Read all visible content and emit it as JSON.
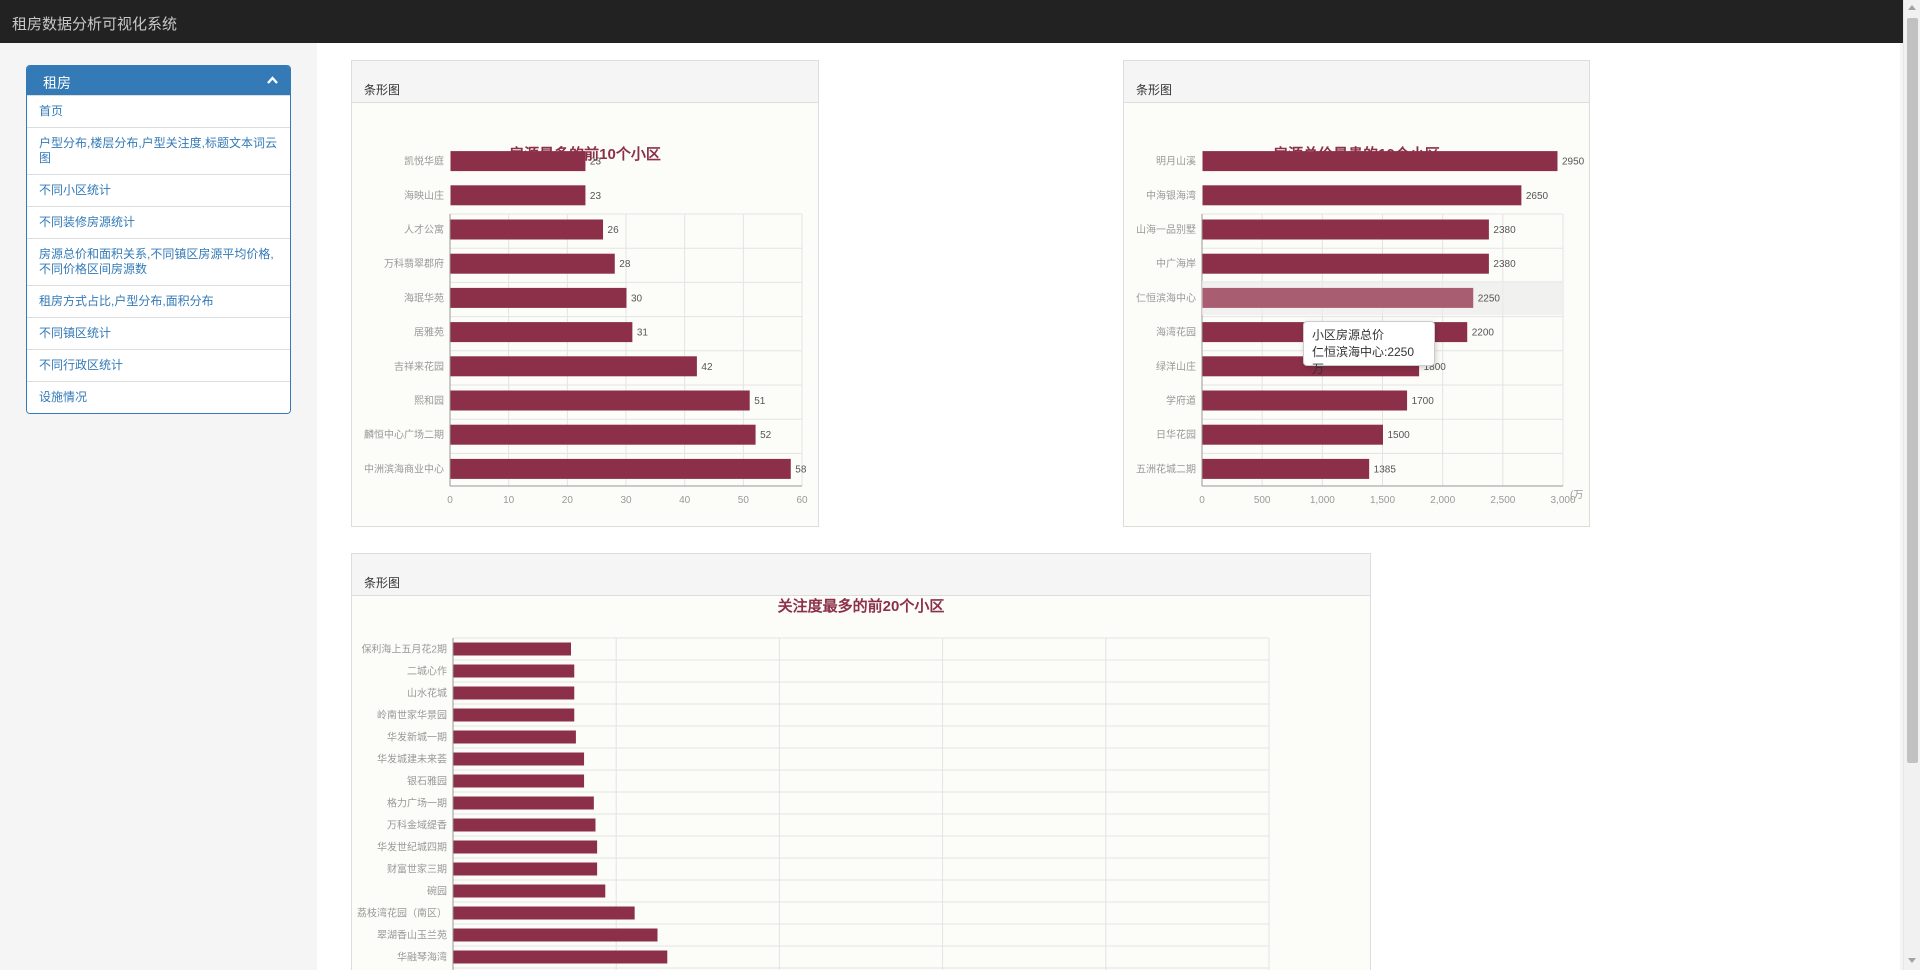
{
  "app": {
    "title": "租房数据分析可视化系统"
  },
  "sidebar": {
    "header": "租房",
    "items": [
      {
        "label": "首页"
      },
      {
        "label": "户型分布,楼层分布,户型关注度,标题文本词云图"
      },
      {
        "label": "不同小区统计"
      },
      {
        "label": "不同装修房源统计"
      },
      {
        "label": "房源总价和面积关系,不同镇区房源平均价格,不同价格区间房源数"
      },
      {
        "label": "租房方式占比,户型分布,面积分布"
      },
      {
        "label": "不同镇区统计"
      },
      {
        "label": "不同行政区统计"
      },
      {
        "label": "设施情况"
      }
    ]
  },
  "panels": [
    {
      "header": "条形图"
    },
    {
      "header": "条形图"
    },
    {
      "header": "条形图"
    }
  ],
  "colors": {
    "bar": "#8b3048",
    "bar_highlight": "#a85d70",
    "title": "#8b3048",
    "accent": "#337ab7"
  },
  "tooltip": {
    "title": "小区房源总价",
    "text": "仁恒滨海中心:2250万"
  },
  "chart_data": [
    {
      "type": "bar",
      "orientation": "horizontal",
      "title": "房源最多的前10个小区",
      "categories": [
        "中洲滨海商业中心",
        "麟恒中心广场二期",
        "熙和园",
        "吉祥来花园",
        "居雅苑",
        "海珉华苑",
        "万科翡翠郡府",
        "人才公寓",
        "海映山庄",
        "凯悦华庭"
      ],
      "values": [
        58,
        52,
        51,
        42,
        31,
        30,
        28,
        26,
        23,
        23
      ],
      "xlim": [
        0,
        60
      ],
      "xticks": [
        0,
        10,
        20,
        30,
        40,
        50,
        60
      ],
      "data_labels": true,
      "grid": true
    },
    {
      "type": "bar",
      "orientation": "horizontal",
      "title": "房源总价最贵的10个小区",
      "categories": [
        "五洲花城二期",
        "日华花园",
        "学府道",
        "绿洋山庄",
        "海湾花园",
        "仁恒滨海中心",
        "中广海岸",
        "山海一品别墅",
        "中海银海湾",
        "明月山溪"
      ],
      "values": [
        1385,
        1500,
        1700,
        1800,
        2200,
        2250,
        2380,
        2380,
        2650,
        2950
      ],
      "xlim": [
        0,
        3000
      ],
      "xticks": [
        "0",
        "500",
        "1,000",
        "1,500",
        "2,000",
        "2,500",
        "3,000"
      ],
      "xunit": "(万",
      "highlight_category": "仁恒滨海中心",
      "data_labels": true,
      "grid": true
    },
    {
      "type": "bar",
      "orientation": "horizontal",
      "title": "关注度最多的前20个小区",
      "categories": [
        "保利海上五月花2期",
        "二城心作",
        "山水花城",
        "岭南世家华景园",
        "华发新城一期",
        "华发城建未来荟",
        "银石雅园",
        "格力广场一期",
        "万科金域缇香",
        "华发世纪城四期",
        "财富世家三期",
        "碗园",
        "荔枝湾花园（南区）",
        "翠湖香山玉兰苑",
        "华融琴海湾"
      ],
      "values": [
        72,
        74,
        74,
        74,
        75,
        80,
        80,
        86,
        87,
        88,
        88,
        93,
        111,
        125,
        131
      ],
      "xlim": [
        0,
        500
      ],
      "data_labels": false,
      "grid": true
    }
  ]
}
